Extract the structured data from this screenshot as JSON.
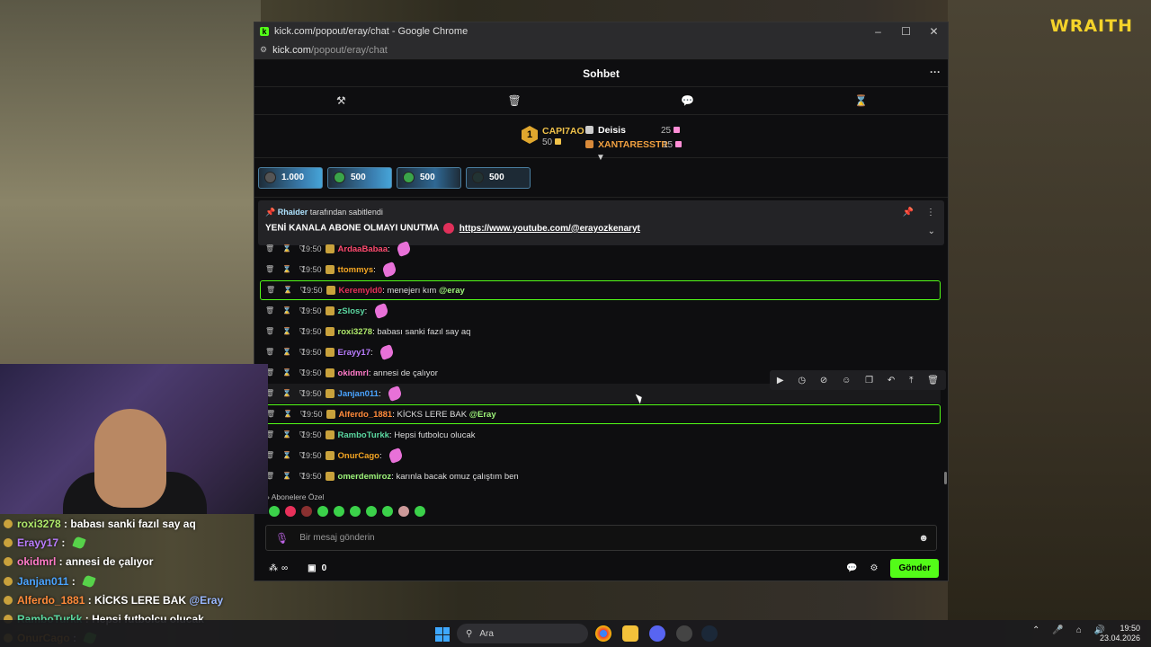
{
  "stream": {
    "brand": "WRAITH"
  },
  "browser": {
    "title": "kick.com/popout/eray/chat - Google Chrome",
    "favicon": "k",
    "url_host": "kick.com",
    "url_path": "/popout/eray/chat",
    "controls": {
      "minimize": "–",
      "maximize": "☐",
      "close": "✕"
    }
  },
  "chat": {
    "header": "Sohbet",
    "more_icon": "···",
    "tools": [
      "hammer-icon",
      "trash-icon",
      "chat-icon",
      "hourglass-icon"
    ],
    "leaderboard": {
      "first": {
        "rank": "1",
        "name": "CAPI7AO",
        "points": "50"
      },
      "second": {
        "name": "Deisis",
        "points": "25"
      },
      "third": {
        "name": "XANTARESSTR",
        "points": "15"
      }
    },
    "gifts": [
      {
        "value": "1.000",
        "fill": 0.95
      },
      {
        "value": "500",
        "fill": 0.95
      },
      {
        "value": "500",
        "fill": 0.6
      },
      {
        "value": "500",
        "fill": 0.0
      }
    ],
    "pinned": {
      "by_user": "Rhaider",
      "by_text": "tarafından sabitlendi",
      "message": "YENİ KANALA ABONE OLMAYI UNUTMA",
      "link": "https://www.youtube.com/@erayozkenaryt"
    },
    "messages": [
      {
        "time": "19:50",
        "user": "ArdaaBabaa",
        "color": "#ff4a6e",
        "sep": ":",
        "text": "",
        "mention": "",
        "emote": true,
        "highlight": false
      },
      {
        "time": "19:50",
        "user": "ttommys",
        "color": "#f5a623",
        "sep": ":",
        "text": "",
        "mention": "",
        "emote": true,
        "highlight": false
      },
      {
        "time": "19:50",
        "user": "Keremyld0",
        "color": "#e8305a",
        "sep": ":",
        "text": "menejerı kım",
        "mention": "@eray",
        "emote": false,
        "highlight": true
      },
      {
        "time": "19:50",
        "user": "zSlosy",
        "color": "#5ad7a0",
        "sep": ":",
        "text": "",
        "mention": "",
        "emote": true,
        "highlight": false
      },
      {
        "time": "19:50",
        "user": "roxi3278",
        "color": "#aee86a",
        "sep": ":",
        "text": "babası sanki fazıl say aq",
        "mention": "",
        "emote": false,
        "highlight": false
      },
      {
        "time": "19:50",
        "user": "Erayy17",
        "color": "#b97cff",
        "sep": ":",
        "text": "",
        "mention": "",
        "emote": true,
        "highlight": false
      },
      {
        "time": "19:50",
        "user": "okidmrl",
        "color": "#ff7ac8",
        "sep": ":",
        "text": "annesi de çalıyor",
        "mention": "",
        "emote": false,
        "highlight": false
      },
      {
        "time": "19:50",
        "user": "Janjan011",
        "color": "#4aa3ff",
        "sep": ":",
        "text": "",
        "mention": "",
        "emote": true,
        "highlight": false
      },
      {
        "time": "19:50",
        "user": "Alferdo_1881",
        "color": "#ff8a3a",
        "sep": ":",
        "text": "KİCKS LERE BAK",
        "mention": "@Eray",
        "emote": false,
        "highlight": true
      },
      {
        "time": "19:50",
        "user": "RamboTurkk",
        "color": "#5ad7a0",
        "sep": ":",
        "text": "Hepsi futbolcu olucak",
        "mention": "",
        "emote": false,
        "highlight": false
      },
      {
        "time": "19:50",
        "user": "OnurCago",
        "color": "#f5a623",
        "sep": ":",
        "text": "",
        "mention": "",
        "emote": true,
        "highlight": false
      },
      {
        "time": "19:50",
        "user": "omerdemiroz",
        "color": "#9ef57a",
        "sep": ":",
        "text": "karınla bacak omuz çalıştım ben",
        "mention": "",
        "emote": false,
        "highlight": false
      }
    ],
    "actions": [
      "play-icon",
      "clock-icon",
      "mute-icon",
      "emote-icon",
      "copy-icon",
      "undo-icon",
      "pin-icon",
      "delete-icon"
    ],
    "sub_only_label": "Abonelere Özel",
    "input_placeholder": "Bir mesaj gönderin",
    "footer": {
      "infinite": "∞",
      "count": "0",
      "send": "Gönder"
    }
  },
  "overlay_chat": [
    {
      "user": "roxi3278",
      "color": "#aee86a",
      "text": "babası sanki fazıl say aq",
      "mention": "",
      "emote": false
    },
    {
      "user": "Erayy17",
      "color": "#b97cff",
      "text": "",
      "mention": "",
      "emote": true
    },
    {
      "user": "okidmrl",
      "color": "#ff7ac8",
      "text": "annesi de çalıyor",
      "mention": "",
      "emote": false
    },
    {
      "user": "Janjan011",
      "color": "#4aa3ff",
      "text": "",
      "mention": "",
      "emote": true
    },
    {
      "user": "Alferdo_1881",
      "color": "#ff8a3a",
      "text": "KİCKS LERE BAK",
      "mention": "@Eray",
      "emote": false
    },
    {
      "user": "RamboTurkk",
      "color": "#5ad7a0",
      "text": "Hepsi futbolcu olucak",
      "mention": "",
      "emote": false
    },
    {
      "user": "OnurCago",
      "color": "#f5a623",
      "text": "",
      "mention": "",
      "emote": true
    }
  ],
  "taskbar": {
    "search_placeholder": "Ara",
    "time": "19:50",
    "date": "23.04.2026"
  }
}
